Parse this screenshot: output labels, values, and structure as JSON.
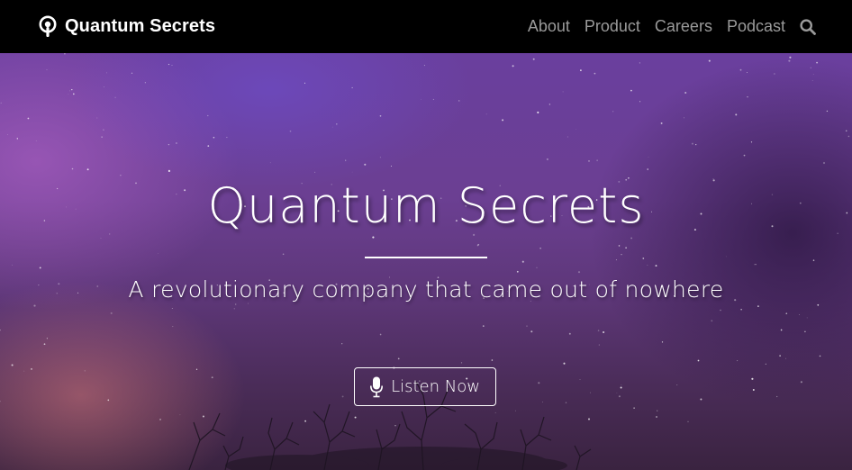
{
  "navbar": {
    "brand_icon": "podcast-icon",
    "brand_label": "Quantum Secrets",
    "links": [
      {
        "label": "About"
      },
      {
        "label": "Product"
      },
      {
        "label": "Careers"
      },
      {
        "label": "Podcast"
      }
    ],
    "search_icon": "search-icon"
  },
  "hero": {
    "title": "Quantum Secrets",
    "subtitle": "A revolutionary company that came out of nowhere",
    "cta": {
      "icon": "microphone-icon",
      "label": "Listen Now"
    }
  },
  "colors": {
    "navbar_bg": "#000000",
    "nav_link": "#9a9a9a",
    "text": "#ffffff",
    "hero_purple": "#6a3f9e"
  }
}
